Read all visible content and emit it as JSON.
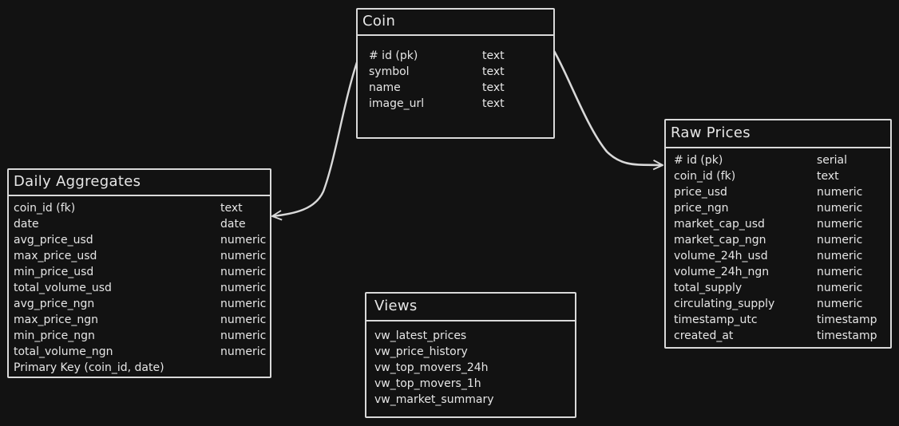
{
  "colors": {
    "background": "#121212",
    "stroke": "#d9d9d9",
    "text": "#e6e6e6"
  },
  "coin": {
    "title": "Coin",
    "fields": [
      {
        "name": "# id (pk)",
        "type": "text"
      },
      {
        "name": "symbol",
        "type": "text"
      },
      {
        "name": "name",
        "type": "text"
      },
      {
        "name": "image_url",
        "type": "text"
      }
    ]
  },
  "daily": {
    "title": "Daily Aggregates",
    "fields": [
      {
        "name": "coin_id (fk)",
        "type": "text"
      },
      {
        "name": "date",
        "type": "date"
      },
      {
        "name": "avg_price_usd",
        "type": "numeric"
      },
      {
        "name": "max_price_usd",
        "type": "numeric"
      },
      {
        "name": "min_price_usd",
        "type": "numeric"
      },
      {
        "name": "total_volume_usd",
        "type": "numeric"
      },
      {
        "name": "avg_price_ngn",
        "type": "numeric"
      },
      {
        "name": "max_price_ngn",
        "type": "numeric"
      },
      {
        "name": "min_price_ngn",
        "type": "numeric"
      },
      {
        "name": "total_volume_ngn",
        "type": "numeric"
      }
    ],
    "primary_key": "Primary Key (coin_id, date)"
  },
  "raw": {
    "title": "Raw Prices",
    "fields": [
      {
        "name": "# id (pk)",
        "type": "serial"
      },
      {
        "name": "coin_id (fk)",
        "type": "text"
      },
      {
        "name": "price_usd",
        "type": "numeric"
      },
      {
        "name": "price_ngn",
        "type": "numeric"
      },
      {
        "name": "market_cap_usd",
        "type": "numeric"
      },
      {
        "name": "market_cap_ngn",
        "type": "numeric"
      },
      {
        "name": "volume_24h_usd",
        "type": "numeric"
      },
      {
        "name": "volume_24h_ngn",
        "type": "numeric"
      },
      {
        "name": "total_supply",
        "type": "numeric"
      },
      {
        "name": "circulating_supply",
        "type": "numeric"
      },
      {
        "name": "timestamp_utc",
        "type": "timestamp"
      },
      {
        "name": "created_at",
        "type": "timestamp"
      }
    ]
  },
  "views": {
    "title": "Views",
    "items": [
      "vw_latest_prices",
      "vw_price_history",
      "vw_top_movers_24h",
      "vw_top_movers_1h",
      "vw_market_summary"
    ]
  }
}
